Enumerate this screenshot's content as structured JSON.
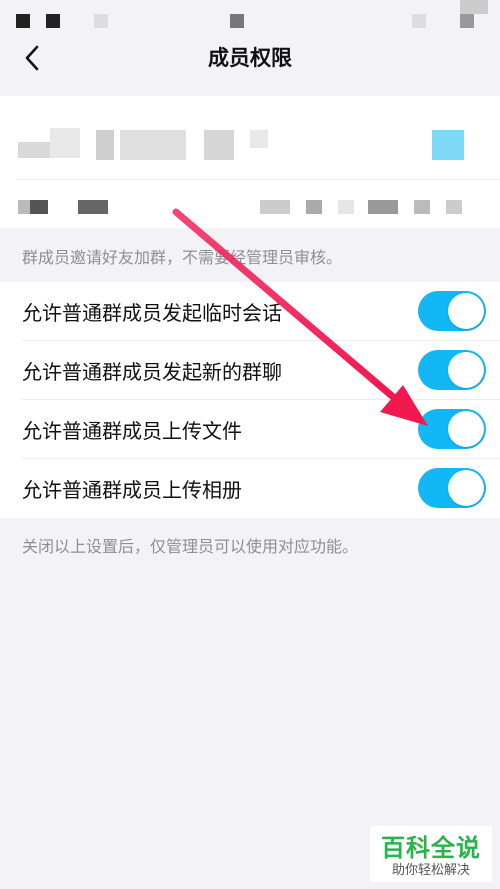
{
  "header": {
    "title": "成员权限",
    "back_icon": "chevron-left-icon"
  },
  "hints": {
    "top": "群成员邀请好友加群，不需要经管理员审核。",
    "bottom": "关闭以上设置后，仅管理员可以使用对应功能。"
  },
  "settings": [
    {
      "label": "允许普通群成员发起临时会话",
      "enabled": true
    },
    {
      "label": "允许普通群成员发起新的群聊",
      "enabled": true
    },
    {
      "label": "允许普通群成员上传文件",
      "enabled": true
    },
    {
      "label": "允许普通群成员上传相册",
      "enabled": true
    }
  ],
  "colors": {
    "toggle_on": "#12b7f5",
    "annotation_arrow": "#f5265e",
    "watermark_green": "#2bb24c"
  },
  "watermark": {
    "main": "百科全说",
    "sub": "助你轻松解决"
  }
}
